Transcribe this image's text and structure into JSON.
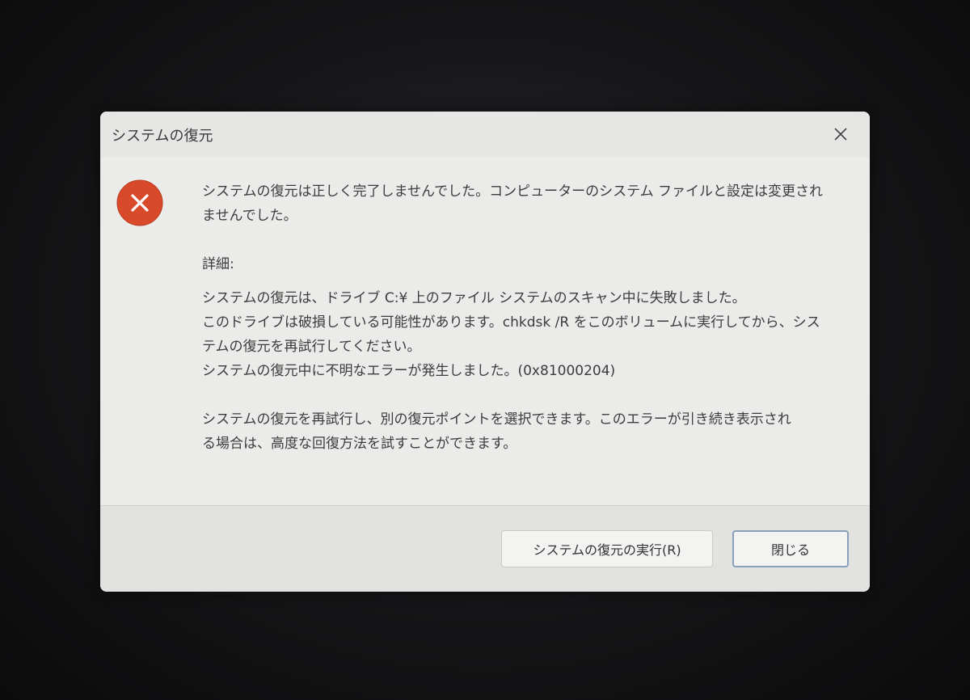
{
  "window": {
    "title": "システムの復元"
  },
  "icons": {
    "error": "error-x-icon",
    "close": "close-icon"
  },
  "colors": {
    "error_icon": "#d94a2b",
    "dialog_bg": "#ebebea",
    "footer_bg": "#e2e2e1"
  },
  "message": {
    "line1": "システムの復元は正しく完了しませんでした。コンピューターのシステム ファイルと設定は変更され",
    "line2": "ませんでした。",
    "details_label": "詳細:",
    "detail1": "システムの復元は、ドライブ C:¥ 上のファイル システムのスキャン中に失敗しました。",
    "detail2": "このドライブは破損している可能性があります。chkdsk /R をこのボリュームに実行してから、シス",
    "detail3": "テムの復元を再試行してください。",
    "detail4": "システムの復元中に不明なエラーが発生しました。(0x81000204)",
    "advice1": "システムの復元を再試行し、別の復元ポイントを選択できます。このエラーが引き続き表示され",
    "advice2": "る場合は、高度な回復方法を試すことができます。"
  },
  "buttons": {
    "run_restore": "システムの復元の実行(R)",
    "close": "閉じる"
  }
}
